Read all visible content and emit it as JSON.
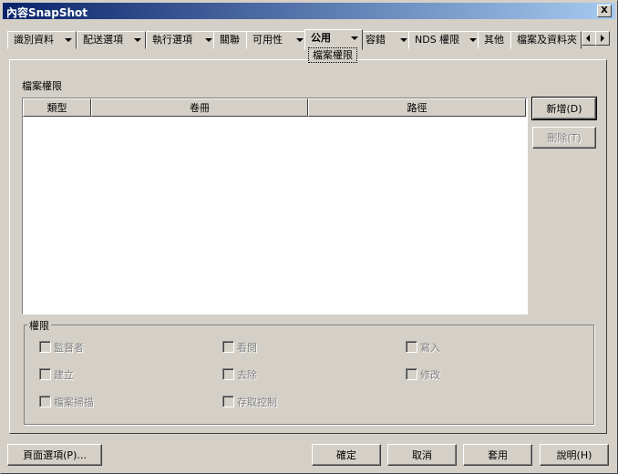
{
  "window": {
    "title": "內容SnapShot",
    "close_label": "X"
  },
  "tabs": [
    {
      "label": "識別資料",
      "has_menu": true
    },
    {
      "label": "配送選項",
      "has_menu": true
    },
    {
      "label": "執行選項",
      "has_menu": true
    },
    {
      "label": "關聯",
      "has_menu": false
    },
    {
      "label": "可用性",
      "has_menu": true
    },
    {
      "label": "公用",
      "has_menu": true
    },
    {
      "label": "容錯",
      "has_menu": true
    },
    {
      "label": "NDS 權限",
      "has_menu": true
    },
    {
      "label": "其他",
      "has_menu": false
    },
    {
      "label": "檔案及資料夾",
      "has_menu": false
    }
  ],
  "active_tab": "公用",
  "active_subtab": "檔案權限",
  "section_label": "檔案權限",
  "table": {
    "columns": [
      "類型",
      "卷冊",
      "路徑"
    ],
    "rows": []
  },
  "side_buttons": {
    "add": "新增(D)",
    "delete": "刪除(T)"
  },
  "rights": {
    "label": "權限",
    "items": [
      "監督者",
      "看閱",
      "寫入",
      "建立",
      "去除",
      "修改",
      "檔案掃描",
      "存取控制"
    ]
  },
  "footer": {
    "page_options": "頁面選項(P)...",
    "ok": "確定",
    "cancel": "取消",
    "apply": "套用",
    "help": "說明(H)"
  }
}
